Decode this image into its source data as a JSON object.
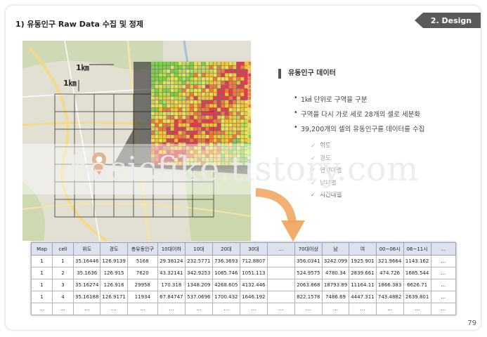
{
  "heading": "1)  유동인구 Raw Data 수집 및 정제",
  "design_tab": "2. Design",
  "map": {
    "km_label_1": "1㎞",
    "km_label_2": "1㎞"
  },
  "info": {
    "title": "유동인구 데이터",
    "bullets": [
      "1㎢ 단위로 구역을 구분",
      "구역을 다시 가로 세로 28개의 셀로 세분화",
      "39,200개의 셀의 유동인구를 데이터를 수집"
    ],
    "checks": [
      "위도",
      "경도",
      "연령대별",
      "남녀별",
      "시간대별"
    ]
  },
  "watermark": "basicfike.tistory.com",
  "table": {
    "headers": [
      "Map",
      "cell",
      "위도",
      "경도",
      "총유동인구",
      "10대이하",
      "10대",
      "20대",
      "30대",
      "…",
      "70대이상",
      "남",
      "여",
      "00~06시",
      "06~11시",
      "…"
    ],
    "rows": [
      [
        "1",
        "1",
        "35.16446",
        "126.9139",
        "5168",
        "29.38124",
        "232.5771",
        "736.3693",
        "712.8807",
        "",
        "356.0341",
        "3242.099",
        "1925.901",
        "321.9664",
        "1143.162",
        "…"
      ],
      [
        "1",
        "2",
        "35.1636",
        "126.915",
        "7620",
        "43.32141",
        "342.9253",
        "1085.746",
        "1051.113",
        "",
        "524.9575",
        "4780.34",
        "2839.661",
        "474.726",
        "1685.544",
        "…"
      ],
      [
        "1",
        "3",
        "35.16274",
        "126.916",
        "29958",
        "170.318",
        "1348.209",
        "4268.605",
        "4132.446",
        "",
        "2063.868",
        "18793.89",
        "11164.11",
        "1866.383",
        "6626.71",
        "…"
      ],
      [
        "1",
        "4",
        "35.16188",
        "126.9171",
        "11934",
        "67.84747",
        "537.0696",
        "1700.432",
        "1646.192",
        "",
        "822.1578",
        "7486.69",
        "4447.311",
        "743.4882",
        "2639.801",
        "…"
      ],
      [
        "…",
        "…",
        "…",
        "…",
        "…",
        "…",
        "…",
        "…",
        "…",
        "…",
        "…",
        "…",
        "…",
        "…",
        "…",
        "…"
      ]
    ]
  },
  "page_number": "79",
  "colors": {
    "tab_bg": "#5a5a5a",
    "arrow": "#f0a35a",
    "pin": "#c9783a",
    "table_header": "#dde3ee"
  }
}
